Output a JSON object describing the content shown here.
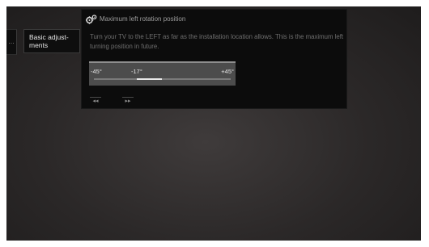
{
  "breadcrumb": {
    "back_icon_glyph": "…",
    "current_label": "Basic adjust-ments"
  },
  "dialog": {
    "title": "Maximum left rotation position",
    "icon": "gears-icon",
    "description": "Turn your TV to the LEFT as far as the installation location allows. This is the maximum left turning position in future."
  },
  "slider": {
    "min_label": "-45°",
    "value_label": "-17°",
    "max_label": "+45°",
    "min": -45,
    "max": 45,
    "value": -17
  },
  "nav": {
    "previous_glyph": "◂◂",
    "next_glyph": "▸▸",
    "previous_icon": "rewind-icon",
    "next_icon": "fast-forward-icon"
  },
  "colors": {
    "panel_background": "#0c0c0c",
    "slider_background": "#4c4c4c",
    "slider_fill": "#e8e8e8"
  }
}
